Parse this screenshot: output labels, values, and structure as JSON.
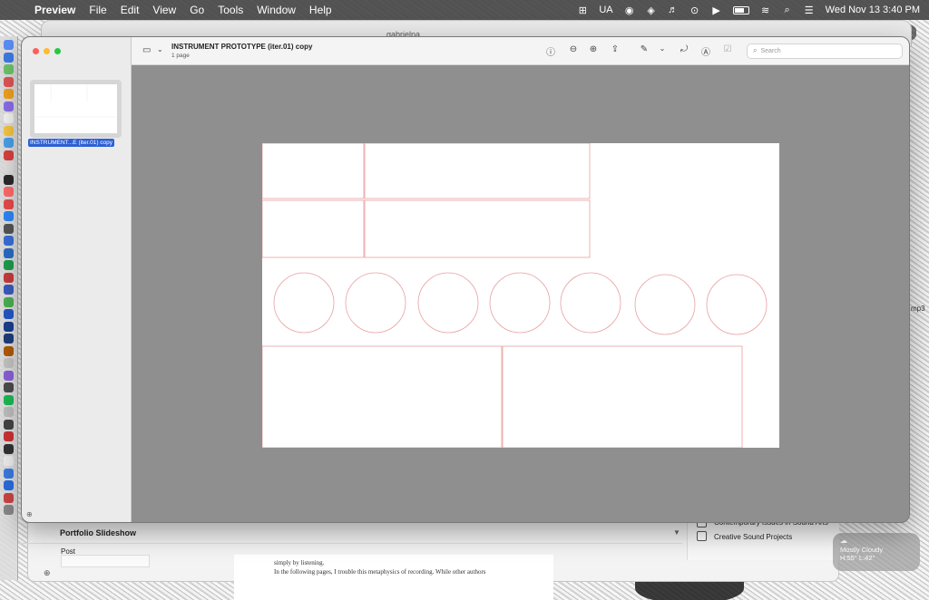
{
  "menubar": {
    "app_name": "Preview",
    "menus": [
      "File",
      "Edit",
      "View",
      "Go",
      "Tools",
      "Window",
      "Help"
    ],
    "input_source": "UA",
    "datetime": "Wed Nov 13  3:40 PM"
  },
  "background_window": {
    "address": "gabrielpa"
  },
  "preview": {
    "doc_title": "INSTRUMENT PROTOTYPE (iter.01) copy",
    "doc_subtitle": "1 page",
    "thumbnail_label": "INSTRUMENT...E (iter.01) copy",
    "search_placeholder": "Search",
    "toolbar_icons": [
      "info-icon",
      "zoom-out-icon",
      "zoom-in-icon",
      "share-icon",
      "markup-pen-icon",
      "rotate-icon",
      "annotate-icon",
      "form-fill-icon"
    ]
  },
  "bottom_window": {
    "portfolio_label": "Portfolio Slideshow",
    "post_label": "Post",
    "checkbox_1": "Contemporary Issues in Sound Arts",
    "checkbox_2": "Creative Sound Projects",
    "doc_line_1": "simply by listening.",
    "doc_line_2": "In the following pages, I trouble this metaphysics of recording. While other authors"
  },
  "weather": {
    "condition": "Mostly Cloudy",
    "hi_lo": "H:55° L:42°"
  },
  "side_label": "mp3",
  "colors": {
    "page_line": "#e8a0a0",
    "selection": "#2d5fd4"
  }
}
